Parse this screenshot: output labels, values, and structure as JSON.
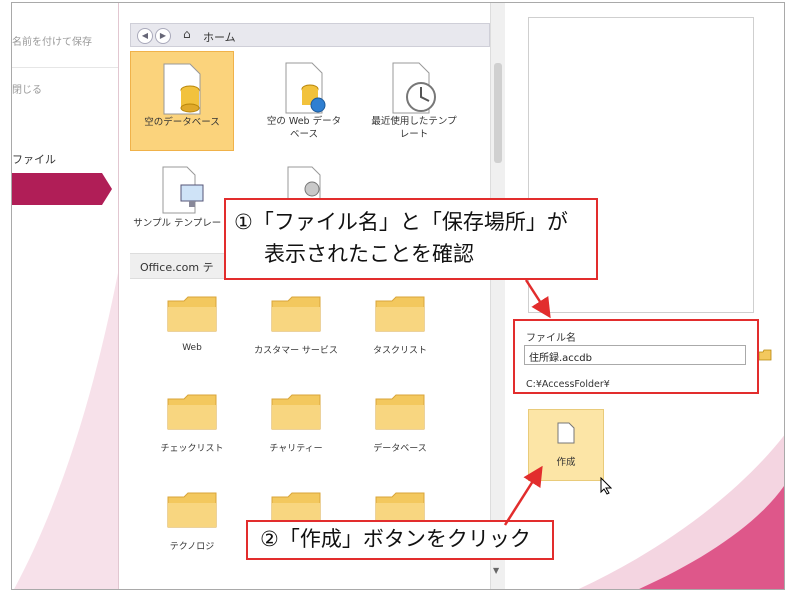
{
  "sidebar": {
    "faded_lines": [
      "名前を付けて保存",
      "閉じる"
    ],
    "file_label": "ファイル"
  },
  "nav": {
    "back_icon": "chevron-left-icon",
    "forward_icon": "chevron-right-icon",
    "home_icon": "home-icon",
    "home_label": "ホーム"
  },
  "templates": [
    {
      "label1": "空のデータベース",
      "label2": ""
    },
    {
      "label1": "空の Web データ",
      "label2": "ベース"
    },
    {
      "label1": "最近使用したテンプ",
      "label2": "レート"
    },
    {
      "label1": "サンプル テンプレート",
      "label2": ""
    },
    {
      "label1": "",
      "label2": ""
    }
  ],
  "section_header": "Office.com テ",
  "folders": [
    "Web",
    "カスタマー サービス",
    "タスクリスト",
    "チェックリスト",
    "チャリティー",
    "データベース",
    "テクノロジ",
    "",
    ""
  ],
  "right": {
    "filename_label": "ファイル名",
    "filename_value": "住所録.accdb",
    "path": "C:¥AccessFolder¥",
    "create_label": "作成"
  },
  "callouts": {
    "step1_line1": "①「ファイル名」と「保存場所」が",
    "step1_line2": "表示されたことを確認",
    "step2": "②「作成」ボタンをクリック"
  },
  "colors": {
    "accent": "#b01e57",
    "selected_tile": "#fbd37c",
    "callout_border": "#e22d2d"
  }
}
